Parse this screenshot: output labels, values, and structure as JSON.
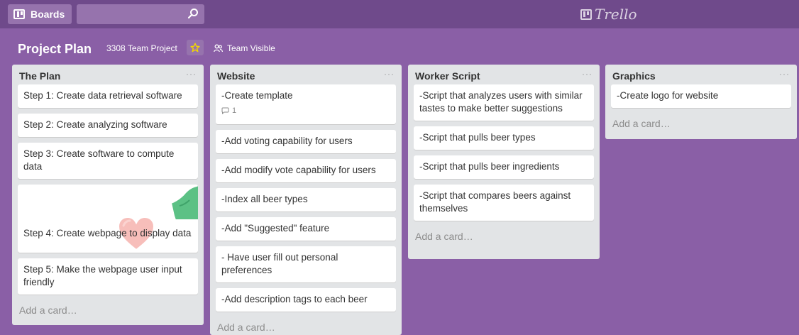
{
  "topbar": {
    "boards_label": "Boards",
    "search_placeholder": "",
    "logo_text": "Trello"
  },
  "board": {
    "title": "Project Plan",
    "team": "3308 Team Project",
    "visibility": "Team Visible"
  },
  "colors": {
    "background": "#8a5fa6",
    "header": "#6f4a8b",
    "list_bg": "#e2e4e6",
    "star": "#f2d600"
  },
  "lists": [
    {
      "title": "The Plan",
      "menu": "···",
      "cards": [
        "Step 1: Create data retrieval software",
        "Step 2: Create analyzing software",
        "Step 3: Create software to compute data",
        "Step 4: Create webpage to display data",
        "Step 5: Make the webpage user input friendly"
      ],
      "add_card": "Add a card…"
    },
    {
      "title": "Website",
      "menu": "···",
      "cards": [
        "-Create template",
        "-Add voting capability for users",
        "-Add modify vote capability for users",
        "-Index all beer types",
        "-Add \"Suggested\" feature",
        "- Have user fill out personal preferences",
        "-Add description tags to each beer"
      ],
      "comment_count": "1",
      "add_card": "Add a card…"
    },
    {
      "title": "Worker Script",
      "menu": "···",
      "cards": [
        "-Script that analyzes users with similar tastes to make better suggestions",
        "-Script that pulls beer types",
        "-Script that pulls beer ingredients",
        "-Script that compares beers against themselves"
      ],
      "add_card": "Add a card…"
    },
    {
      "title": "Graphics",
      "menu": "···",
      "cards": [
        "-Create logo for website"
      ],
      "add_card": "Add a card…"
    }
  ]
}
